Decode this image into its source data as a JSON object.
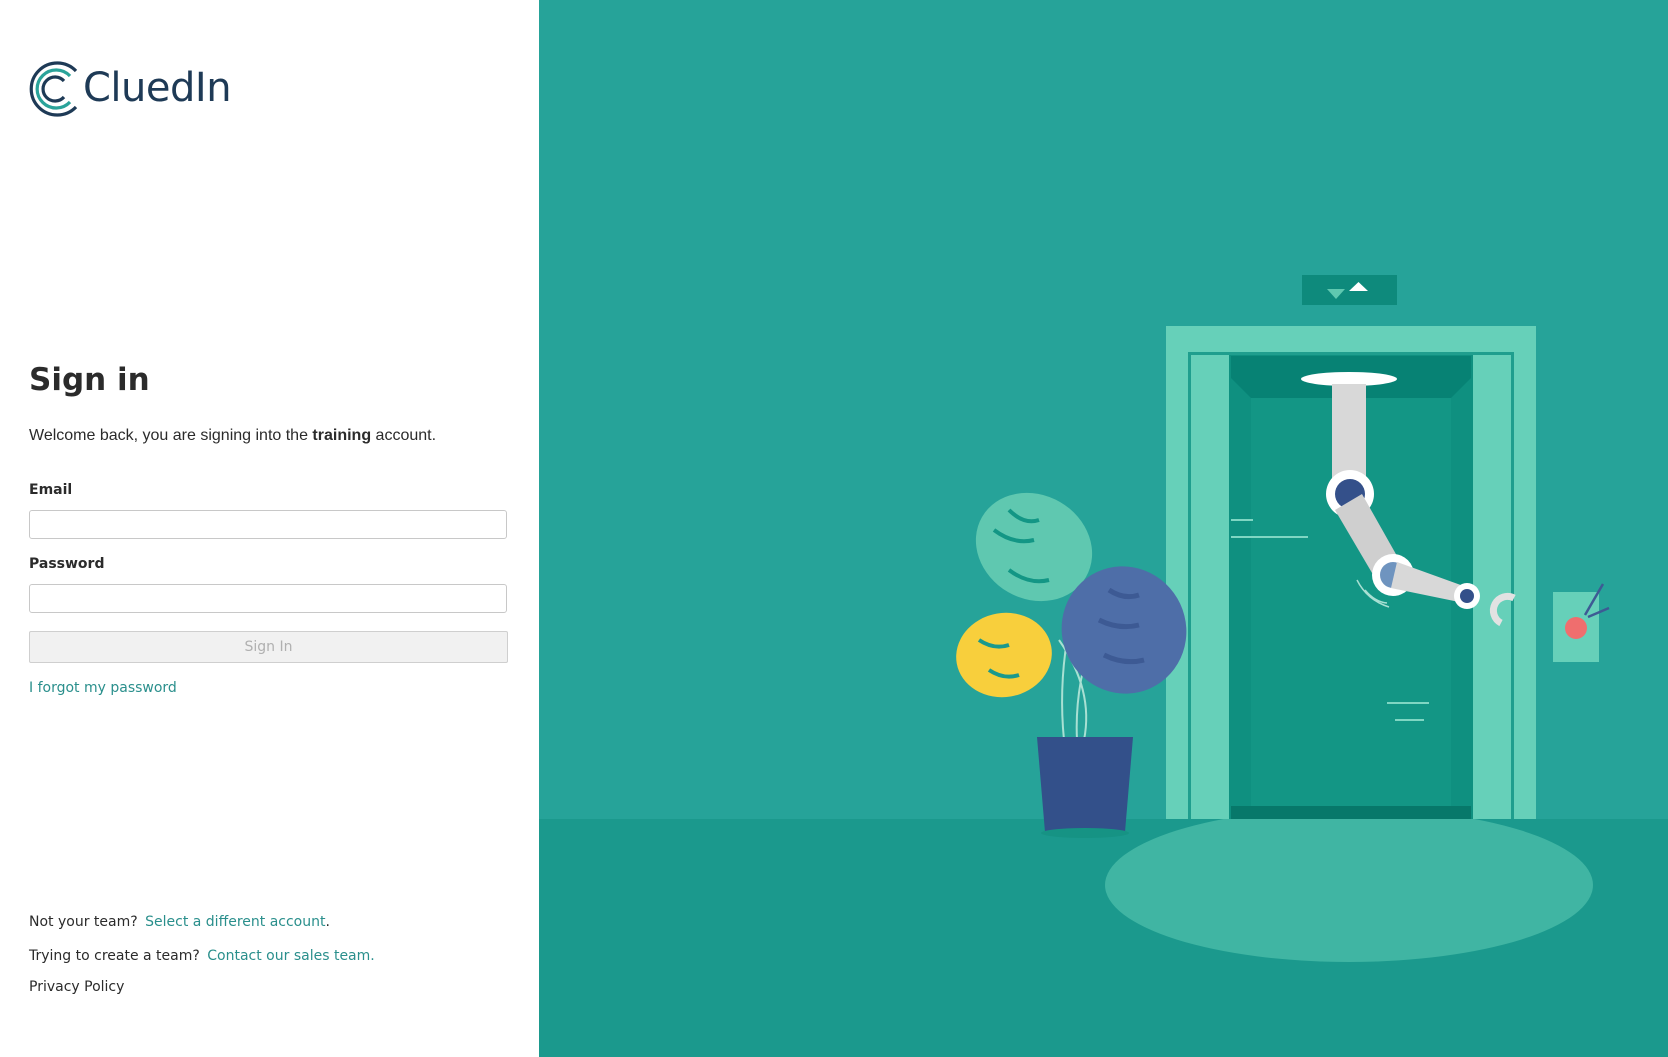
{
  "brand": {
    "name": "CluedIn"
  },
  "signin": {
    "title": "Sign in",
    "welcome_prefix": "Welcome back, you are signing into the ",
    "account_name": "training",
    "welcome_suffix": " account.",
    "email_label": "Email",
    "email_value": "",
    "password_label": "Password",
    "password_value": "",
    "submit_label": "Sign In",
    "forgot_label": "I forgot my password"
  },
  "footer": {
    "not_team_text": "Not your team?",
    "select_account_link": "Select a different account",
    "period": ".",
    "create_team_text": "Trying to create a team?",
    "contact_sales_link": "Contact our sales team.",
    "privacy_link": "Privacy Policy"
  },
  "colors": {
    "accent": "#2a8f8c",
    "illustration_bg": "#26a399",
    "floor": "#1b998d"
  }
}
